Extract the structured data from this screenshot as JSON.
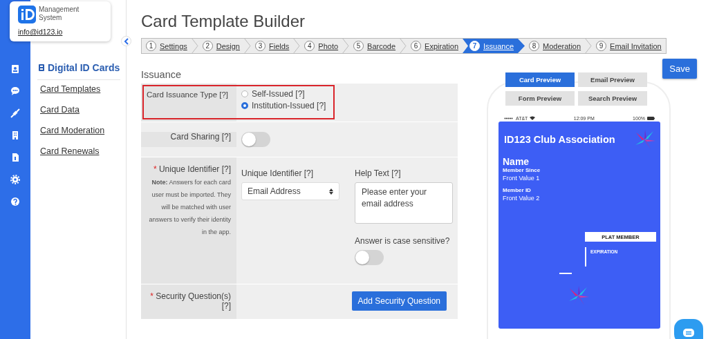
{
  "brand": {
    "name": "Management System",
    "email": "info@id123.io"
  },
  "sidebar": {
    "heading": "Digital ID Cards",
    "items": [
      {
        "label": "Card Templates"
      },
      {
        "label": "Card Data"
      },
      {
        "label": "Card Moderation"
      },
      {
        "label": "Card Renewals"
      }
    ]
  },
  "page_title": "Card Template Builder",
  "steps": [
    {
      "number": "1",
      "label": "Settings",
      "selected": false
    },
    {
      "number": "2",
      "label": "Design",
      "selected": false
    },
    {
      "number": "3",
      "label": "Fields",
      "selected": false
    },
    {
      "number": "4",
      "label": "Photo",
      "selected": false
    },
    {
      "number": "5",
      "label": "Barcode",
      "selected": false
    },
    {
      "number": "6",
      "label": "Expiration",
      "selected": false
    },
    {
      "number": "7",
      "label": "Issuance",
      "selected": true
    },
    {
      "number": "8",
      "label": "Moderation",
      "selected": false
    },
    {
      "number": "9",
      "label": "Email Invitation",
      "selected": false
    }
  ],
  "save_button": "Save",
  "section_title": "Issuance",
  "form": [
    {
      "kind": "radio",
      "label": "Card Issuance Type [?]",
      "highlighted": true,
      "options": [
        {
          "label": "Self-Issued [?]",
          "selected": false
        },
        {
          "label": "Institution-Issued [?]",
          "selected": true
        }
      ]
    },
    {
      "kind": "toggle",
      "label": "Card Sharing [?]",
      "on": false
    },
    {
      "kind": "identifier",
      "marker": "*",
      "label": "Unique Identifier [?]",
      "note": "**Note:** Answers for each card user must be imported. They will be matched with user answers to verify their identity in the app.",
      "select_label": "Unique Identifier [?]",
      "select_value": "Email Address",
      "help_label": "Help Text [?]",
      "help_value": "Please enter your email address",
      "case_label": "Answer is case sensitive?",
      "case_sensitive": false
    },
    {
      "kind": "button",
      "marker": "*",
      "label": "Security Question(s) [?]",
      "button": "Add Security Question"
    }
  ],
  "preview_tabs": [
    {
      "label": "Card Preview",
      "selected": true
    },
    {
      "label": "Email Preview",
      "selected": false
    },
    {
      "label": "Form Preview",
      "selected": false
    },
    {
      "label": "Search Preview",
      "selected": false
    }
  ],
  "phone": {
    "carrier": "AT&T",
    "time": "12:09 PM",
    "battery": "100%"
  },
  "card": {
    "title": "ID123 Club Association",
    "name": "Name",
    "fields": [
      {
        "label": "Member Since",
        "value": "Front Value 1"
      },
      {
        "label": "Member ID",
        "value": "Front Value 2"
      }
    ],
    "badge": "PLAT MEMBER",
    "expiration_label": "EXPIRATION"
  }
}
